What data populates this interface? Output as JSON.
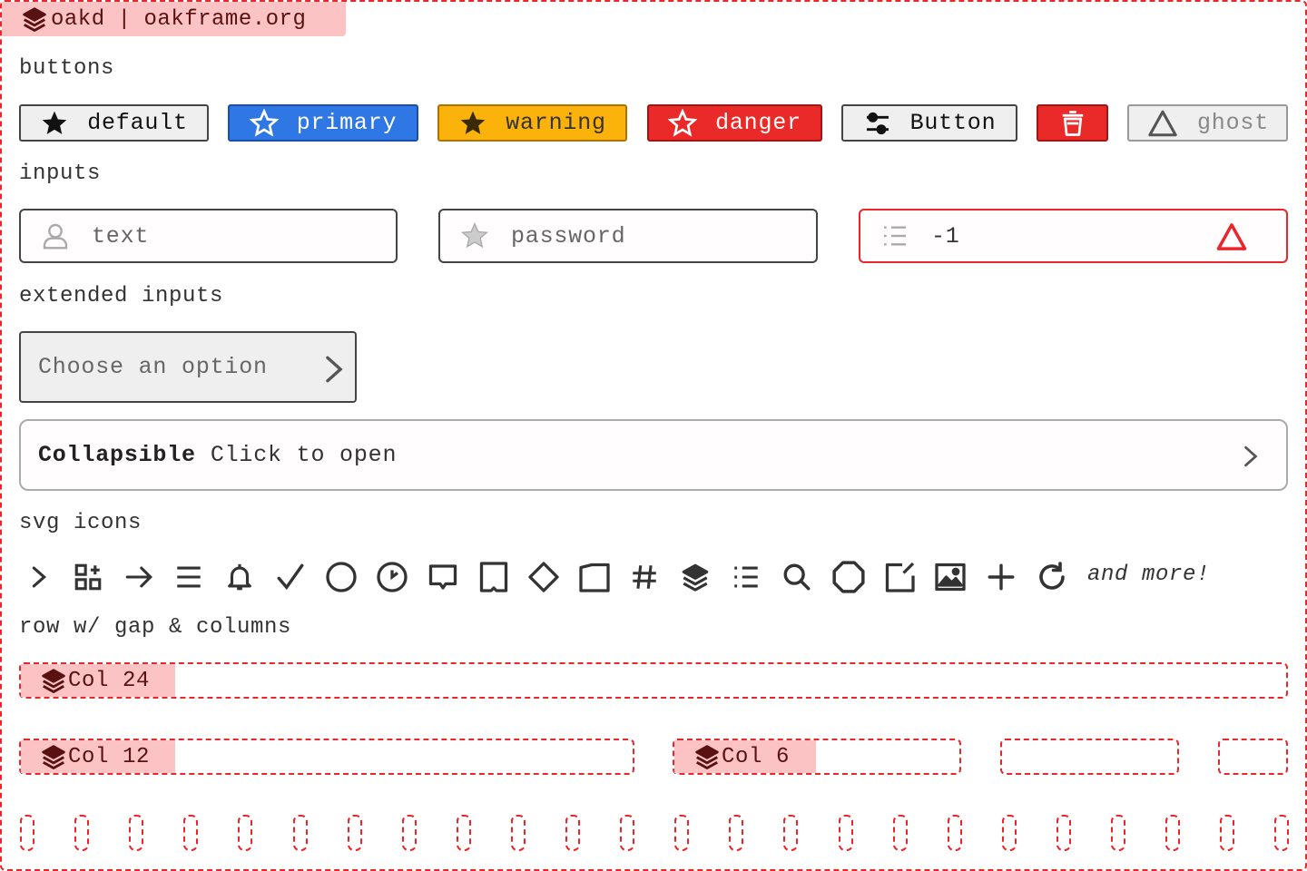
{
  "header": {
    "brand": "oakd",
    "separator": "|",
    "site": "oakframe.org"
  },
  "sections": {
    "buttons": "buttons",
    "inputs": "inputs",
    "extended": "extended inputs",
    "icons": "svg icons",
    "row": "row w/ gap & columns"
  },
  "buttons": {
    "default": "default",
    "primary": "primary",
    "warning": "warning",
    "danger": "danger",
    "button": "Button",
    "ghost": "ghost"
  },
  "inputs": {
    "text_placeholder": "text",
    "password_placeholder": "password",
    "number_value": "-1"
  },
  "select": {
    "placeholder": "Choose an option"
  },
  "collapsible": {
    "title": "Collapsible",
    "hint": "Click to open"
  },
  "icons": {
    "list": [
      "chevron-right",
      "grid-add",
      "arrow-right",
      "menu",
      "bell",
      "check",
      "circle",
      "clock",
      "message",
      "book",
      "diamond",
      "folder",
      "hash",
      "layers",
      "list",
      "search",
      "octagon",
      "edit",
      "image",
      "plus",
      "refresh"
    ],
    "and_more": "and more!"
  },
  "columns": {
    "col24": "Col 24",
    "col12": "Col 12",
    "col6": "Col 6"
  },
  "colors": {
    "accent": "#e8262b",
    "primary": "#2f77e4",
    "warning": "#fbb20b",
    "danger": "#ea2929",
    "tag_bg": "#fbc3c4"
  }
}
